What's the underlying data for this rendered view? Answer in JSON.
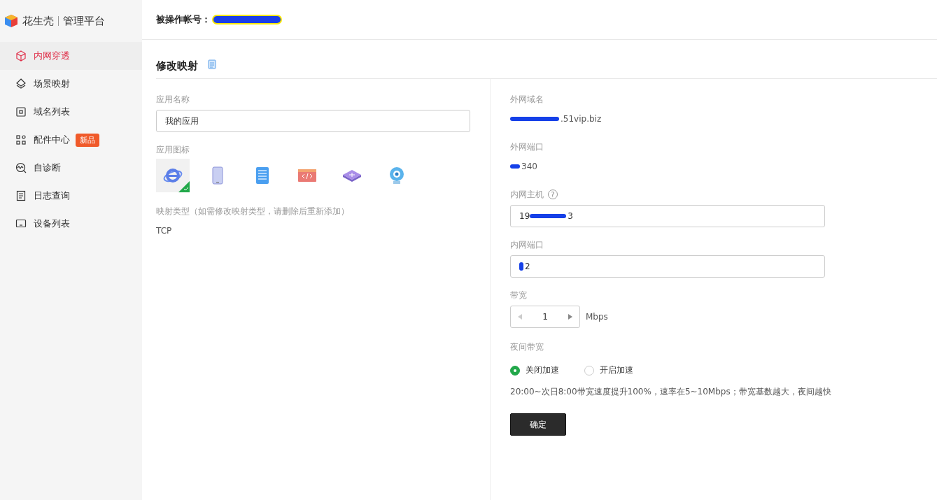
{
  "logo": {
    "brand": "花生壳",
    "product": "管理平台"
  },
  "sidebar": {
    "items": [
      {
        "label": "内网穿透",
        "kind": "cube",
        "selected": true
      },
      {
        "label": "场景映射",
        "kind": "layers",
        "selected": false
      },
      {
        "label": "域名列表",
        "kind": "square",
        "selected": false
      },
      {
        "label": "配件中心",
        "kind": "grid",
        "selected": false,
        "badge": "新品"
      },
      {
        "label": "自诊断",
        "kind": "pulse",
        "selected": false
      },
      {
        "label": "日志查询",
        "kind": "doc",
        "selected": false
      },
      {
        "label": "设备列表",
        "kind": "monitor",
        "selected": false
      }
    ]
  },
  "header": {
    "account_label": "被操作帐号："
  },
  "form": {
    "title": "修改映射",
    "app_name": {
      "label": "应用名称",
      "value": "我的应用"
    },
    "app_icon": {
      "label": "应用图标",
      "options": [
        {
          "kind": "browser",
          "selected": true
        },
        {
          "kind": "tablet",
          "selected": false
        },
        {
          "kind": "server",
          "selected": false
        },
        {
          "kind": "code",
          "selected": false
        },
        {
          "kind": "router",
          "selected": false
        },
        {
          "kind": "camera",
          "selected": false
        }
      ]
    },
    "mapping_type": {
      "label": "映射类型（如需修改映射类型，请删除后重新添加）",
      "value": "TCP"
    },
    "domain": {
      "label": "外网域名",
      "value": ".51vip.biz"
    },
    "external_port": {
      "label": "外网端口",
      "value": "340"
    },
    "internal_host": {
      "label": "内网主机",
      "help": "?",
      "value_start": "19",
      "value_end": "3"
    },
    "internal_port": {
      "label": "内网端口",
      "value": "2"
    },
    "bandwidth": {
      "label": "带宽",
      "value": "1",
      "unit": "Mbps"
    },
    "night": {
      "label": "夜间带宽",
      "options": [
        {
          "label": "关闭加速",
          "selected": true
        },
        {
          "label": "开启加速",
          "selected": false
        }
      ],
      "note": "20:00~次日8:00带宽速度提升100%，速率在5~10Mbps；带宽基数越大，夜间越快"
    },
    "submit": "确定"
  }
}
